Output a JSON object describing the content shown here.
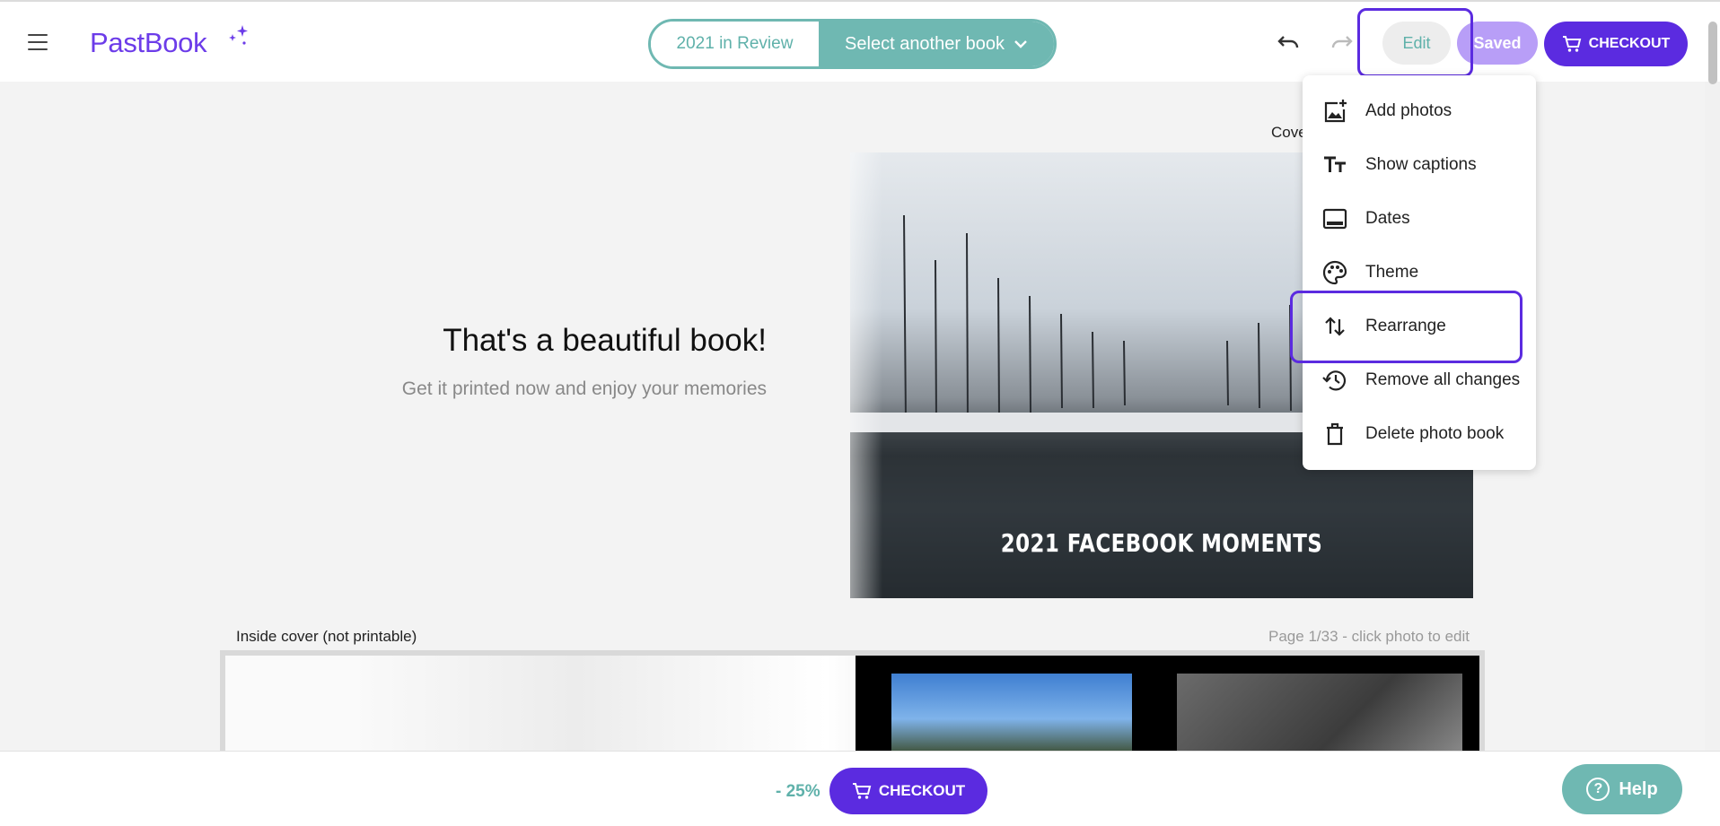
{
  "header": {
    "brand": "PastBook",
    "book_current": "2021 in Review",
    "book_select": "Select another book",
    "edit_label": "Edit",
    "saved_label": "Saved",
    "checkout_label": "CHECKOUT"
  },
  "edit_menu": {
    "items": [
      {
        "label": "Add photos",
        "icon": "add-photo-icon"
      },
      {
        "label": "Show captions",
        "icon": "text-size-icon"
      },
      {
        "label": "Dates",
        "icon": "calendar-strip-icon"
      },
      {
        "label": "Theme",
        "icon": "palette-icon"
      },
      {
        "label": "Rearrange",
        "icon": "swap-vertical-icon"
      },
      {
        "label": "Remove all changes",
        "icon": "history-icon"
      },
      {
        "label": "Delete photo book",
        "icon": "trash-icon"
      }
    ]
  },
  "preview": {
    "headline": "That's a beautiful book!",
    "subline": "Get it printed now and enjoy your memories",
    "cover_label": "Cove",
    "cover_title": "2021 FACEBOOK MOMENTS",
    "inside_label": "Inside cover (not printable)",
    "page_label": "Page 1/33  - click photo to edit"
  },
  "footer": {
    "discount": "- 25%",
    "checkout_label": "CHECKOUT",
    "help_label": "Help"
  },
  "colors": {
    "brand": "#6c3ce9",
    "accent_purple": "#5b2be0",
    "teal": "#6fb8b2",
    "saved": "#b89ef7"
  }
}
